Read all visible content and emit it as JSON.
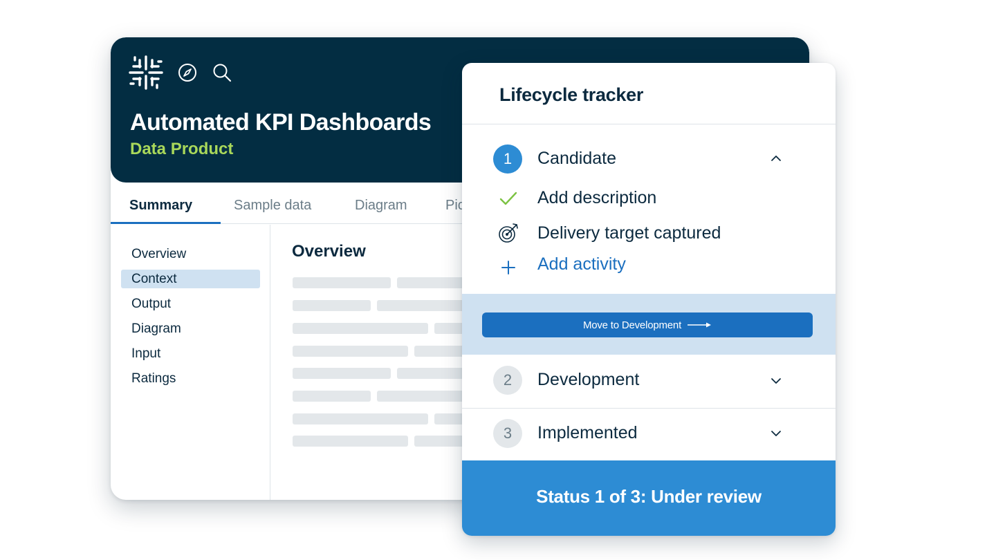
{
  "app": {
    "title": "Automated KPI Dashboards",
    "subtitle": "Data Product",
    "header_icons": [
      "logo-icon",
      "compass-icon",
      "search-icon"
    ]
  },
  "tabs": [
    {
      "label": "Summary",
      "active": true
    },
    {
      "label": "Sample data",
      "active": false
    },
    {
      "label": "Diagram",
      "active": false
    },
    {
      "label": "Pic",
      "active": false
    }
  ],
  "sidebar": {
    "items": [
      {
        "label": "Overview",
        "active": false
      },
      {
        "label": "Context",
        "active": true
      },
      {
        "label": "Output",
        "active": false
      },
      {
        "label": "Diagram",
        "active": false
      },
      {
        "label": "Input",
        "active": false
      },
      {
        "label": "Ratings",
        "active": false
      }
    ]
  },
  "content": {
    "title": "Overview"
  },
  "tracker": {
    "title": "Lifecycle tracker",
    "steps": [
      {
        "number": "1",
        "label": "Candidate",
        "state": "active",
        "expanded": true
      },
      {
        "number": "2",
        "label": "Development",
        "state": "idle",
        "expanded": false
      },
      {
        "number": "3",
        "label": "Implemented",
        "state": "idle",
        "expanded": false
      }
    ],
    "tasks": [
      {
        "label": "Add description",
        "icon": "check-icon"
      },
      {
        "label": "Delivery target captured",
        "icon": "target-icon"
      },
      {
        "label": "Add activity",
        "icon": "plus-icon"
      }
    ],
    "move_button": "Move to Development",
    "status": "Status 1 of 3: Under review"
  },
  "colors": {
    "header_bg": "#032d42",
    "subtitle": "#a9d85a",
    "accent_blue": "#1b6fbf",
    "status_blue": "#2d8cd4",
    "highlight": "#cfe1f1",
    "check_green": "#7cc242"
  }
}
